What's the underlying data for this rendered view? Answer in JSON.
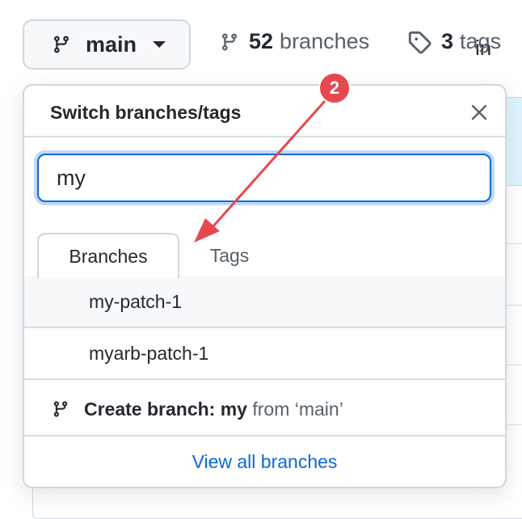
{
  "topbar": {
    "branch_button": {
      "label": "main",
      "icon": "git-branch-icon"
    },
    "branches_stat": {
      "count": "52",
      "label": "branches",
      "icon": "git-branch-icon"
    },
    "tags_stat": {
      "count": "3",
      "label": "tags",
      "icon": "tag-icon"
    }
  },
  "background": {
    "peek_text": "in"
  },
  "dropdown": {
    "title": "Switch branches/tags",
    "close_icon": "x-icon",
    "search": {
      "value": "my",
      "placeholder": ""
    },
    "tabs": [
      {
        "label": "Branches",
        "active": true
      },
      {
        "label": "Tags",
        "active": false
      }
    ],
    "items": [
      {
        "label": "my-patch-1"
      },
      {
        "label": "myarb-patch-1"
      }
    ],
    "create": {
      "icon": "git-branch-icon",
      "prefix": "Create branch: ",
      "name": "my",
      "suffix": " from ‘main’"
    },
    "footer_link": "View all branches"
  },
  "annotation": {
    "badge": "2",
    "color": "#e5484d"
  },
  "colors": {
    "accent": "#0969da",
    "border": "#d0d7de",
    "annotation": "#e5484d"
  }
}
